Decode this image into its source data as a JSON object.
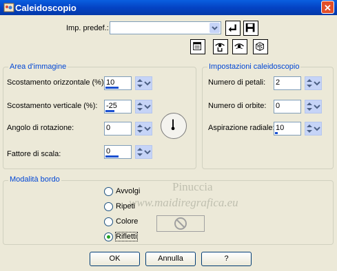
{
  "window": {
    "title": "Caleidoscopio",
    "close_glyph": "✕"
  },
  "preset": {
    "label": "Imp. predef.:",
    "value": ""
  },
  "area": {
    "legend": "Area d'immagine",
    "fields": [
      {
        "label": "Scostamento orizzontale (%):",
        "value": "10",
        "fill": 0.5
      },
      {
        "label": "Scostamento verticale (%):",
        "value": "-25",
        "fill": 0.35
      },
      {
        "label": "Angolo di rotazione:",
        "value": "0",
        "fill": 0
      },
      {
        "label": "Fattore di scala:",
        "value": "0",
        "fill": 0.5
      }
    ]
  },
  "kaleido": {
    "legend": "Impostazioni caleidoscopio",
    "fields": [
      {
        "label": "Numero di petali:",
        "value": "2",
        "fill": 0
      },
      {
        "label": "Numero di orbite:",
        "value": "0",
        "fill": 0
      },
      {
        "label": "Aspirazione radiale:",
        "value": "10",
        "fill": 0.1
      }
    ]
  },
  "edge": {
    "legend": "Modalità bordo",
    "options": [
      {
        "label": "Avvolgi",
        "selected": false
      },
      {
        "label": "Ripeti",
        "selected": false
      },
      {
        "label": "Colore",
        "selected": false
      },
      {
        "label": "Rifletti",
        "selected": true
      }
    ]
  },
  "watermark": {
    "line1": "Pinuccia",
    "line2": "www.maidiregrafica.eu"
  },
  "buttons": {
    "ok": "OK",
    "cancel": "Annulla",
    "help": "?"
  }
}
